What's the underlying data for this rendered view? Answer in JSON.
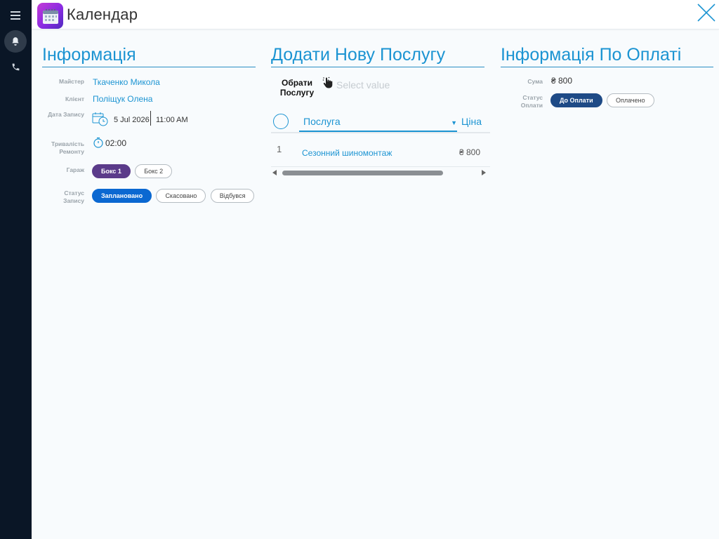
{
  "app": {
    "title": "Календар"
  },
  "info": {
    "title": "Інформація",
    "master_label": "Майстер",
    "master": "Ткаченко Микола",
    "client_label": "Клієнт",
    "client": "Поліщук Олена",
    "date_label": "Дата Запису",
    "date": "5 Jul 2026",
    "time": "11:00 AM",
    "duration_label": "Тривалість Ремонту",
    "duration": "02:00",
    "garage_label": "Гараж",
    "garages": [
      "Бокс 1",
      "Бокс 2"
    ],
    "status_label": "Статус Запису",
    "statuses": [
      "Заплановано",
      "Скасовано",
      "Відбувся"
    ]
  },
  "service": {
    "title": "Додати Нову Послугу",
    "choose_label": "Обрати Послугу",
    "placeholder": "Select value",
    "col_service": "Послуга",
    "col_price": "Ціна",
    "rows": [
      {
        "num": "1",
        "service": "Сезонний шиномонтаж",
        "price": "₴ 800"
      }
    ]
  },
  "payment": {
    "title": "Інформація По Оплаті",
    "sum_label": "Сума",
    "sum": "₴ 800",
    "status_label": "Статус Оплати",
    "statuses": [
      "До Оплати",
      "Оплачено"
    ]
  },
  "colors": {
    "accent": "#1c94d2",
    "rail": "#0a1626"
  }
}
